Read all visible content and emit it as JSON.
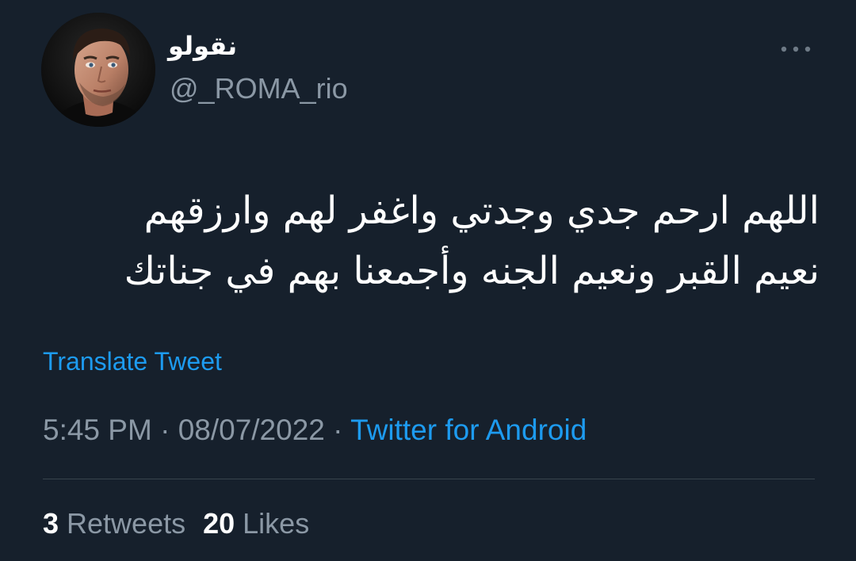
{
  "user": {
    "display_name": "نقولو",
    "handle": "@_ROMA_rio"
  },
  "tweet": {
    "line1": "اللهم ارحم جدي وجدتي واغفر لهم وارزقهم",
    "line2": "نعيم القبر ونعيم الجنه وأجمعنا بهم في جناتك"
  },
  "translate_label": "Translate Tweet",
  "meta": {
    "time": "5:45 PM",
    "date": "08/07/2022",
    "separator": " · ",
    "source": "Twitter for Android"
  },
  "stats": {
    "retweets_count": "3",
    "retweets_label": " Retweets",
    "likes_count": "20",
    "likes_label": " Likes"
  },
  "icons": {
    "more": "more-horizontal-icon"
  },
  "colors": {
    "background": "#16202c",
    "accent": "#1d9bf0",
    "secondary_text": "#8b98a5",
    "divider": "#38444d"
  }
}
